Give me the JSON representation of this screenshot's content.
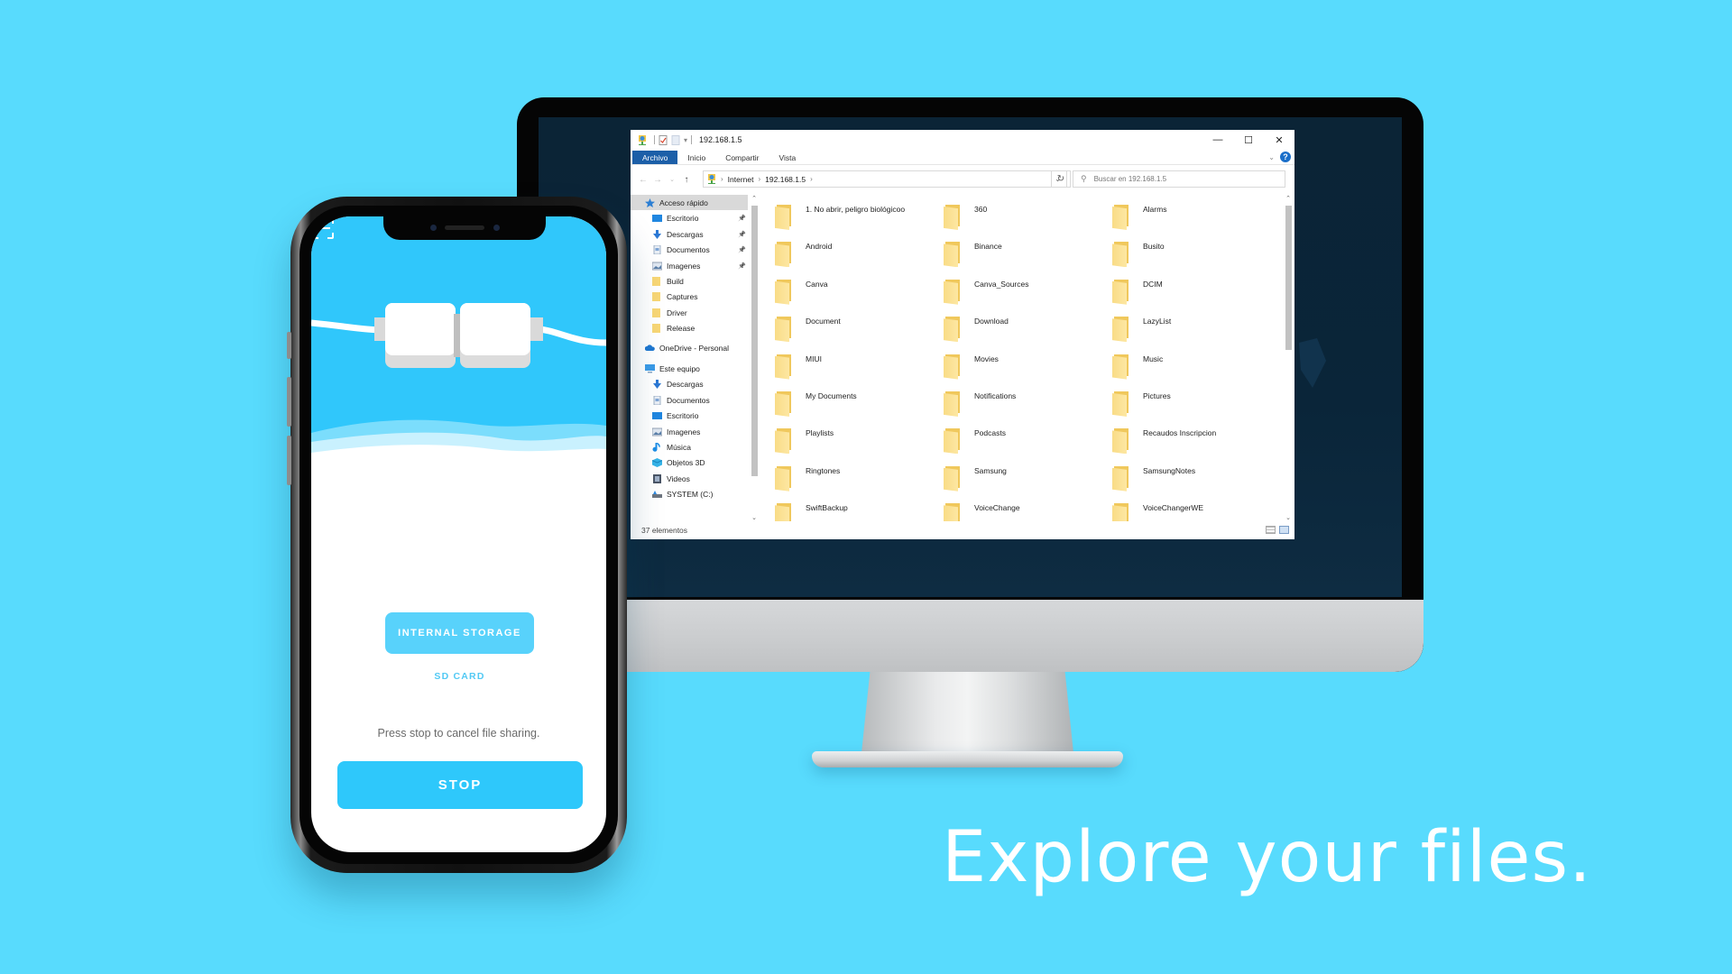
{
  "explorer": {
    "title": "192.168.1.5",
    "window_controls": {
      "minimize": "—",
      "maximize": "☐",
      "close": "✕"
    },
    "ribbon_tabs": [
      "Archivo",
      "Inicio",
      "Compartir",
      "Vista"
    ],
    "active_tab": "Archivo",
    "help_label": "?",
    "address": {
      "segments": [
        "Internet",
        "192.168.1.5"
      ]
    },
    "search_placeholder": "Buscar en 192.168.1.5",
    "nav_pane": [
      {
        "label": "Acceso rápido",
        "icon": "star-icon",
        "pinned": false,
        "selected": true,
        "indent": 0
      },
      {
        "label": "Escritorio",
        "icon": "desktop-icon",
        "pinned": true,
        "indent": 1
      },
      {
        "label": "Descargas",
        "icon": "download-icon",
        "pinned": true,
        "indent": 1
      },
      {
        "label": "Documentos",
        "icon": "document-icon",
        "pinned": true,
        "indent": 1
      },
      {
        "label": "Imagenes",
        "icon": "image-icon",
        "pinned": true,
        "indent": 1
      },
      {
        "label": "Build",
        "icon": "folder-icon",
        "pinned": false,
        "indent": 1
      },
      {
        "label": "Captures",
        "icon": "folder-icon",
        "pinned": false,
        "indent": 1
      },
      {
        "label": "Driver",
        "icon": "folder-icon",
        "pinned": false,
        "indent": 1
      },
      {
        "label": "Release",
        "icon": "folder-icon",
        "pinned": false,
        "indent": 1
      },
      {
        "label": "OneDrive - Personal",
        "icon": "cloud-icon",
        "pinned": false,
        "indent": 0
      },
      {
        "label": "Este equipo",
        "icon": "computer-icon",
        "pinned": false,
        "indent": 0
      },
      {
        "label": "Descargas",
        "icon": "download-icon",
        "pinned": false,
        "indent": 1
      },
      {
        "label": "Documentos",
        "icon": "document-icon",
        "pinned": false,
        "indent": 1
      },
      {
        "label": "Escritorio",
        "icon": "desktop-icon",
        "pinned": false,
        "indent": 1
      },
      {
        "label": "Imagenes",
        "icon": "image-icon",
        "pinned": false,
        "indent": 1
      },
      {
        "label": "Música",
        "icon": "music-icon",
        "pinned": false,
        "indent": 1
      },
      {
        "label": "Objetos 3D",
        "icon": "cube-icon",
        "pinned": false,
        "indent": 1
      },
      {
        "label": "Videos",
        "icon": "video-icon",
        "pinned": false,
        "indent": 1
      },
      {
        "label": "SYSTEM (C:)",
        "icon": "drive-icon",
        "pinned": false,
        "indent": 1
      }
    ],
    "files": [
      "1. No abrir, peligro biológicoo",
      "360",
      "Alarms",
      "Android",
      "Binance",
      "Busito",
      "Canva",
      "Canva_Sources",
      "DCIM",
      "Document",
      "Download",
      "LazyList",
      "MIUI",
      "Movies",
      "Music",
      "My Documents",
      "Notifications",
      "Pictures",
      "Playlists",
      "Podcasts",
      "Recaudos Inscripcion",
      "Ringtones",
      "Samsung",
      "SamsungNotes",
      "SwiftBackup",
      "VoiceChange",
      "VoiceChangerWE"
    ],
    "status": "37 elementos"
  },
  "phone": {
    "internal_storage_label": "INTERNAL STORAGE",
    "sd_card_label": "SD CARD",
    "hint": "Press stop to cancel file sharing.",
    "stop_label": "STOP"
  },
  "tagline": "Explore your files.",
  "colors": {
    "background": "#58dbfd",
    "app_accent": "#2ec8fb",
    "ribbon_active": "#1c5fa8",
    "folder": "#f9dc86"
  }
}
